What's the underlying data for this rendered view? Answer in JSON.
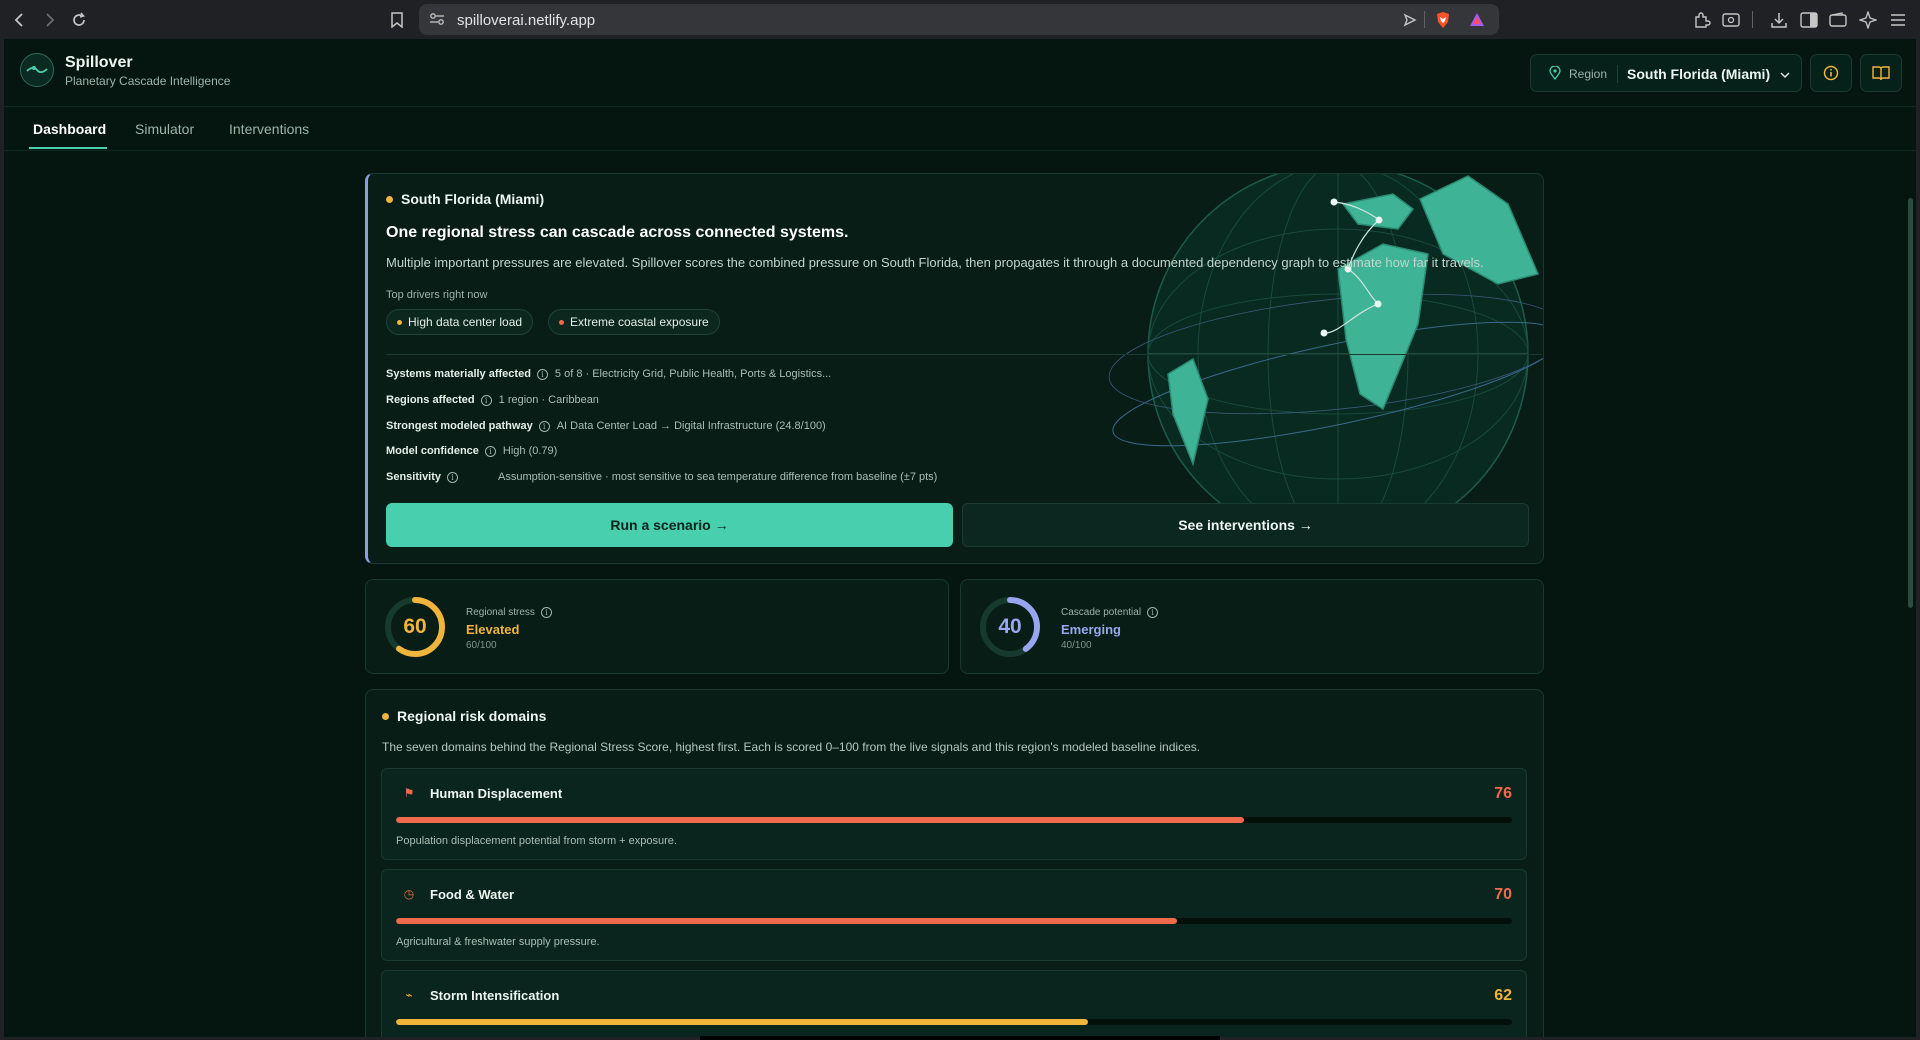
{
  "browser": {
    "url": "spilloverai.netlify.app"
  },
  "app": {
    "name": "Spillover",
    "tagline": "Planetary Cascade Intelligence",
    "region_label": "Region",
    "region_value": "South Florida (Miami)"
  },
  "tabs": [
    {
      "label": "Dashboard",
      "active": true
    },
    {
      "label": "Simulator",
      "active": false
    },
    {
      "label": "Interventions",
      "active": false
    }
  ],
  "hero": {
    "region": "South Florida (Miami)",
    "headline": "One regional stress can cascade across connected systems.",
    "description": "Multiple important pressures are elevated. Spillover scores the combined pressure on South Florida, then propagates it through a documented dependency graph to estimate how far it travels.",
    "drivers_label": "Top drivers right now",
    "drivers": [
      {
        "label": "High data center load",
        "color": "#f0b53a"
      },
      {
        "label": "Extreme coastal exposure",
        "color": "#ef6b4c"
      }
    ],
    "info": [
      {
        "key": "Systems materially affected",
        "value": "5 of 8 · Electricity Grid, Public Health, Ports & Logistics..."
      },
      {
        "key": "Regions affected",
        "value": "1 region · Caribbean"
      },
      {
        "key": "Strongest modeled pathway",
        "value": "AI Data Center Load → Digital Infrastructure (24.8/100)"
      },
      {
        "key": "Model confidence",
        "value": "High (0.79)"
      },
      {
        "key": "Sensitivity",
        "value": "Assumption-sensitive · most sensitive to sea temperature difference from baseline (±7 pts)"
      }
    ],
    "primary_button": "Run a scenario →",
    "secondary_button": "See interventions →"
  },
  "scores": [
    {
      "label": "Regional stress",
      "value": "60",
      "level": "Elevated",
      "sub": "60/100",
      "fraction": 0.6,
      "color": "#f0b53a"
    },
    {
      "label": "Cascade potential",
      "value": "40",
      "level": "Emerging",
      "sub": "40/100",
      "fraction": 0.4,
      "color": "#98a6f0"
    }
  ],
  "risk": {
    "title": "Regional risk domains",
    "description": "The seven domains behind the Regional Stress Score, highest first. Each is scored 0–100 from the live signals and this region's modeled baseline indices.",
    "domains": [
      {
        "name": "Human Displacement",
        "score": "76",
        "fraction": 0.76,
        "desc": "Population displacement potential from storm + exposure.",
        "icon": "flag-icon",
        "glyph": "⚑",
        "color": "#ef6b4c"
      },
      {
        "name": "Food & Water",
        "score": "70",
        "fraction": 0.7,
        "desc": "Agricultural & freshwater supply pressure.",
        "icon": "clock-icon",
        "glyph": "◷",
        "color": "#ef6b4c"
      },
      {
        "name": "Storm Intensification",
        "score": "62",
        "fraction": 0.62,
        "desc": "",
        "icon": "wind-icon",
        "glyph": "⌁",
        "color": "#f0b53a"
      }
    ]
  }
}
